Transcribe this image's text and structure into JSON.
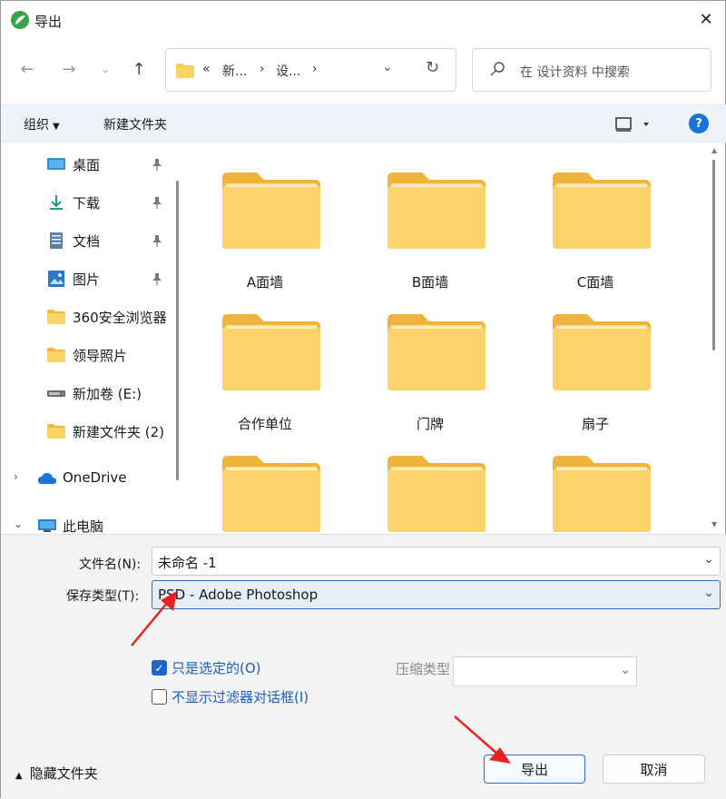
{
  "window": {
    "title": "导出"
  },
  "nav": {
    "address_segments": [
      "«",
      "新...",
      "›",
      "设...",
      "›"
    ],
    "search_placeholder": "在 设计资料 中搜索"
  },
  "toolbar": {
    "organize_label": "组织",
    "new_folder_label": "新建文件夹"
  },
  "sidebar": {
    "quick_access": [
      {
        "label": "桌面",
        "icon": "desktop-icon",
        "pinned": true
      },
      {
        "label": "下载",
        "icon": "download-icon",
        "pinned": true
      },
      {
        "label": "文档",
        "icon": "document-icon",
        "pinned": true
      },
      {
        "label": "图片",
        "icon": "pictures-icon",
        "pinned": true
      },
      {
        "label": "360安全浏览器",
        "icon": "folder-icon",
        "pinned": false
      },
      {
        "label": "领导照片",
        "icon": "folder-icon",
        "pinned": false
      },
      {
        "label": "新加卷 (E:)",
        "icon": "drive-icon",
        "pinned": false
      },
      {
        "label": "新建文件夹 (2)",
        "icon": "folder-icon",
        "pinned": false
      }
    ],
    "tree": [
      {
        "label": "OneDrive",
        "icon": "cloud-icon",
        "expanded": false
      },
      {
        "label": "此电脑",
        "icon": "computer-icon",
        "expanded": true
      }
    ]
  },
  "files": [
    {
      "name": "A面墙"
    },
    {
      "name": "B面墙"
    },
    {
      "name": "C面墙"
    },
    {
      "name": "合作单位"
    },
    {
      "name": "门牌"
    },
    {
      "name": "扇子"
    },
    {
      "name": ""
    },
    {
      "name": ""
    },
    {
      "name": ""
    }
  ],
  "form": {
    "filename_label": "文件名(N):",
    "filename_value": "未命名 -1",
    "filetype_label": "保存类型(T):",
    "filetype_value": "PSD - Adobe Photoshop",
    "only_selected_label": "只是选定的(O)",
    "only_selected_checked": true,
    "no_filter_dialog_label": "不显示过滤器对话框(I)",
    "no_filter_dialog_checked": false,
    "compress_label": "压缩类型",
    "compress_value": ""
  },
  "footer": {
    "hide_folders_label": "隐藏文件夹",
    "export_label": "导出",
    "cancel_label": "取消"
  },
  "colors": {
    "accent": "#1a67c7",
    "folder": "#f8c94e",
    "annotation": "#e8231f"
  }
}
